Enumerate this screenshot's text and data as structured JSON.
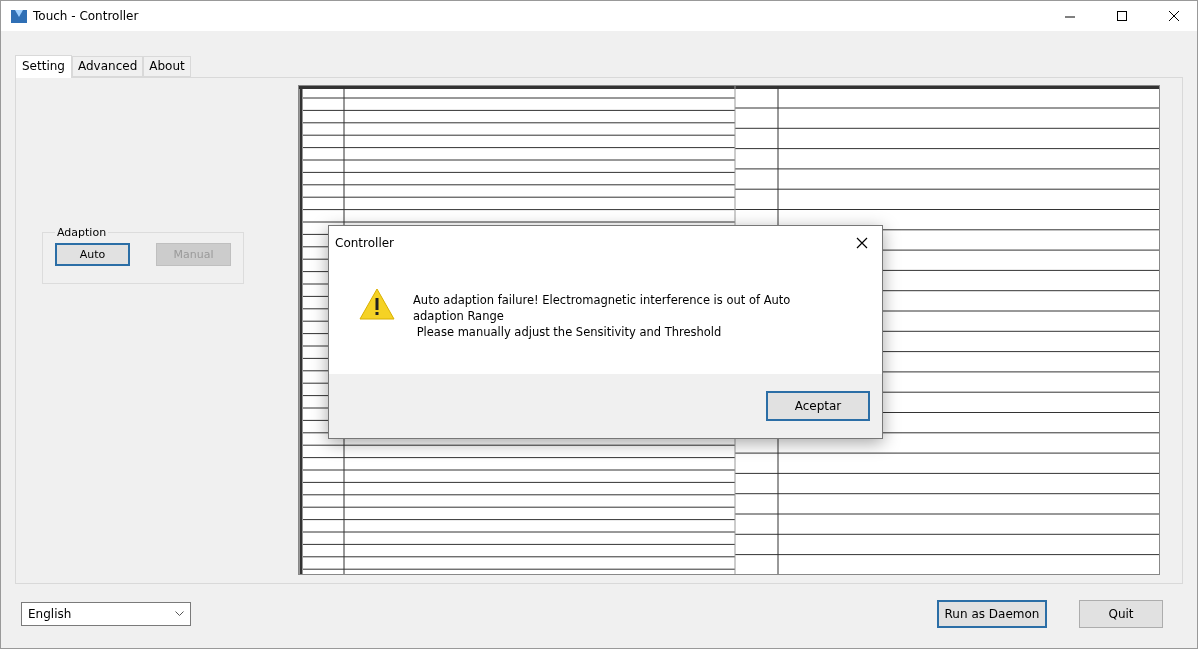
{
  "window": {
    "title": "Touch - Controller"
  },
  "tabs": [
    {
      "label": "Setting",
      "selected": true
    },
    {
      "label": "Advanced",
      "selected": false
    },
    {
      "label": "About",
      "selected": false
    }
  ],
  "adaption": {
    "label": "Adaption",
    "buttons": [
      {
        "label": "Auto",
        "disabled": false,
        "focused": true
      },
      {
        "label": "Manual",
        "disabled": true,
        "focused": false
      }
    ]
  },
  "dialog": {
    "title": "Controller",
    "message_lines": [
      "Auto adaption failure! Electromagnetic interference is out of Auto",
      "adaption Range",
      " Please manually adjust the Sensitivity and Threshold"
    ],
    "button": "Aceptar"
  },
  "language": {
    "value": "English"
  },
  "buttons": [
    {
      "label": "Run as Daemon",
      "focused": true
    },
    {
      "label": "Quit",
      "focused": false
    }
  ]
}
